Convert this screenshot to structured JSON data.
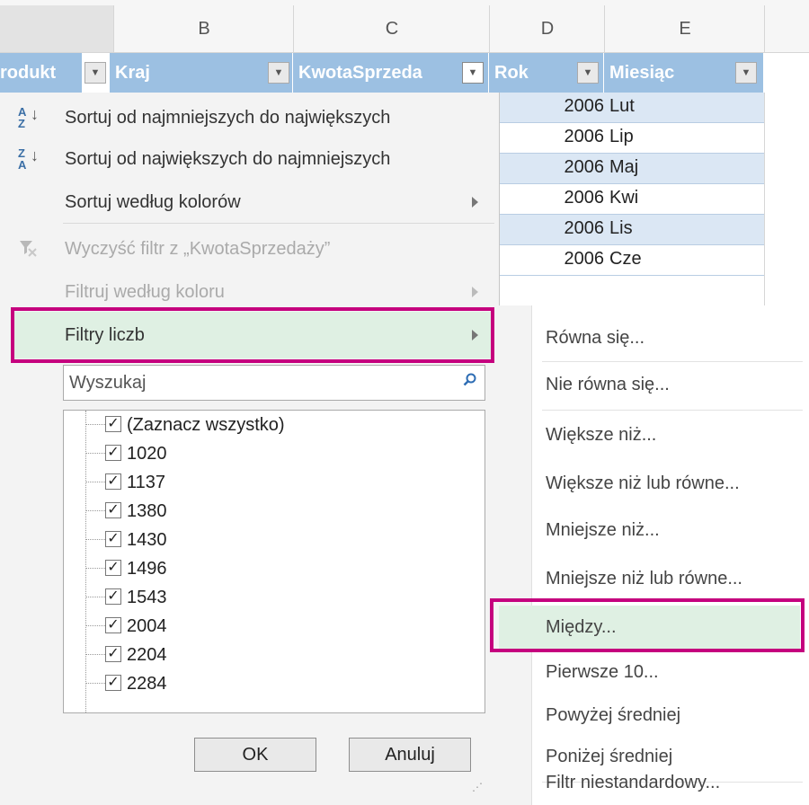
{
  "columns": [
    "B",
    "C",
    "D",
    "E"
  ],
  "table_headers": {
    "produkt": "rodukt",
    "kraj": "Kraj",
    "kwota": "KwotaSprzeda",
    "rok": "Rok",
    "miesiac": "Miesiąc"
  },
  "data_rows": [
    {
      "rok": "2006",
      "miesiac": "Lut"
    },
    {
      "rok": "2006",
      "miesiac": "Lip"
    },
    {
      "rok": "2006",
      "miesiac": "Maj"
    },
    {
      "rok": "2006",
      "miesiac": "Kwi"
    },
    {
      "rok": "2006",
      "miesiac": "Lis"
    },
    {
      "rok": "2006",
      "miesiac": "Cze"
    }
  ],
  "menu": {
    "sort_asc": "Sortuj od najmniejszych do największych",
    "sort_desc": "Sortuj od największych do najmniejszych",
    "sort_color": "Sortuj według kolorów",
    "clear_filter": "Wyczyść filtr z „KwotaSprzedaży”",
    "filter_color": "Filtruj według koloru",
    "number_filters": "Filtry liczb",
    "sort_asc_icon_top": "A",
    "sort_asc_icon_bottom": "Z",
    "sort_desc_icon_top": "Z",
    "sort_desc_icon_bottom": "A"
  },
  "search": {
    "placeholder": "Wyszukaj"
  },
  "checklist": [
    {
      "label": "(Zaznacz wszystko)",
      "checked": true
    },
    {
      "label": "1020",
      "checked": true
    },
    {
      "label": "1137",
      "checked": true
    },
    {
      "label": "1380",
      "checked": true
    },
    {
      "label": "1430",
      "checked": true
    },
    {
      "label": "1496",
      "checked": true
    },
    {
      "label": "1543",
      "checked": true
    },
    {
      "label": "2004",
      "checked": true
    },
    {
      "label": "2204",
      "checked": true
    },
    {
      "label": "2284",
      "checked": true
    }
  ],
  "buttons": {
    "ok": "OK",
    "cancel": "Anuluj"
  },
  "submenu": [
    "Równa się...",
    "Nie równa się...",
    "Większe niż...",
    "Większe niż lub równe...",
    "Mniejsze niż...",
    "Mniejsze niż lub równe...",
    "Między...",
    "Pierwsze 10...",
    "Powyżej średniej",
    "Poniżej średniej",
    "Filtr niestandardowy..."
  ],
  "colors": {
    "highlight_border": "#c5007e",
    "highlight_fill": "#dff0e3",
    "header_blue": "#9cc0e2",
    "band_blue": "#dbe7f4"
  }
}
